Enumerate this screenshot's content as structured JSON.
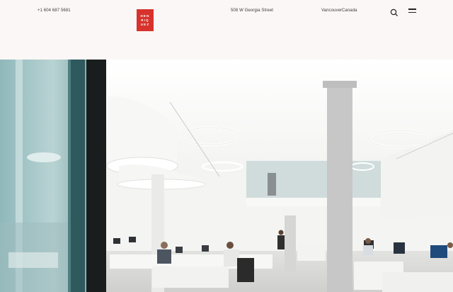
{
  "header": {
    "phone": "+1 604 687 5681",
    "address": "508 W Georgia Street",
    "city": "Vancouver",
    "country": "Canada",
    "logo_lines": [
      "HEN",
      "RIQ",
      "UEZ"
    ],
    "brand_color": "#d7322c",
    "icons": {
      "search": "search-icon",
      "menu": "menu-icon"
    }
  },
  "hero": {
    "image": "open-plan-office-photo"
  }
}
